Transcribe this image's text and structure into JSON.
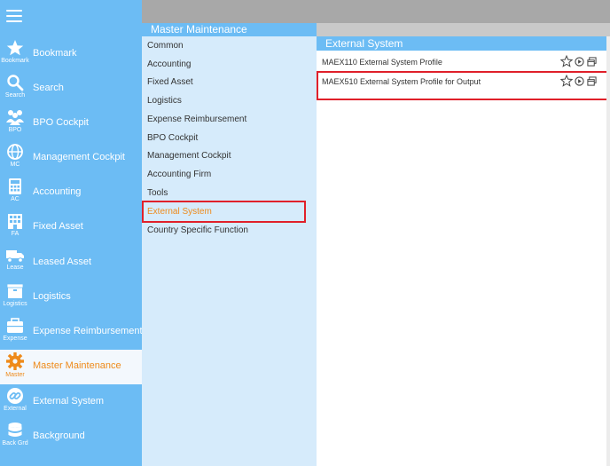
{
  "sidebar": {
    "items": [
      {
        "label": "Bookmark",
        "abbr": "Bookmark",
        "icon": "star-icon"
      },
      {
        "label": "Search",
        "abbr": "Search",
        "icon": "search-icon"
      },
      {
        "label": "BPO Cockpit",
        "abbr": "BPO",
        "icon": "people-icon"
      },
      {
        "label": "Management Cockpit",
        "abbr": "MC",
        "icon": "globe-icon"
      },
      {
        "label": "Accounting",
        "abbr": "AC",
        "icon": "calculator-icon"
      },
      {
        "label": "Fixed Asset",
        "abbr": "FA",
        "icon": "building-icon"
      },
      {
        "label": "Leased Asset",
        "abbr": "Lease",
        "icon": "truck-icon"
      },
      {
        "label": "Logistics",
        "abbr": "Logistics",
        "icon": "box-icon"
      },
      {
        "label": "Expense Reimbursement",
        "abbr": "Expense",
        "icon": "wallet-icon"
      },
      {
        "label": "Master Maintenance",
        "abbr": "Master",
        "icon": "gear-icon",
        "active": true
      },
      {
        "label": "External System",
        "abbr": "External",
        "icon": "link-icon"
      },
      {
        "label": "Background",
        "abbr": "Back Grd",
        "icon": "database-icon"
      }
    ]
  },
  "master_panel": {
    "title": "Master Maintenance",
    "items": [
      "Common",
      "Accounting",
      "Fixed Asset",
      "Logistics",
      "Expense Reimbursement",
      "BPO Cockpit",
      "Management Cockpit",
      "Accounting Firm",
      "Tools",
      "External System",
      "Country Specific Function"
    ],
    "selected": "External System"
  },
  "external_panel": {
    "title": "External System",
    "programs": [
      {
        "label": "MAEX110 External System Profile"
      },
      {
        "label": "MAEX510 External System Profile for Output",
        "highlighted": true
      }
    ]
  },
  "colors": {
    "sidebar": "#6cbcf4",
    "active_text": "#ee8a1a",
    "highlight_border": "#e0202a",
    "panel_bg": "#d6ebfb"
  }
}
